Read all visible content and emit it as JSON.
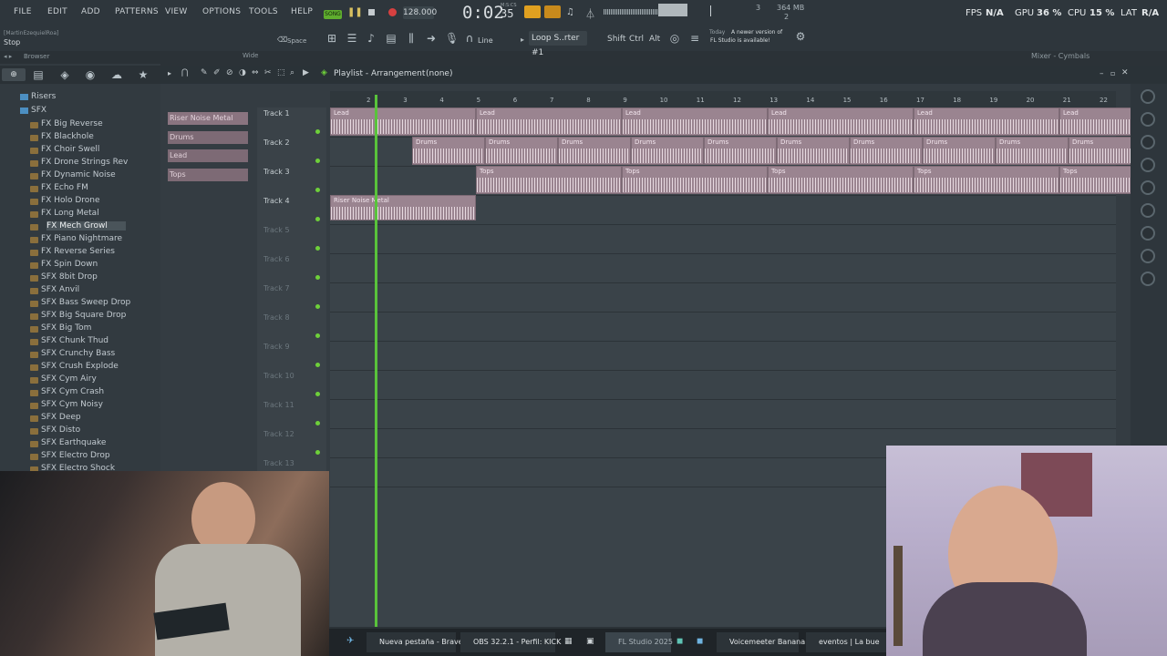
{
  "menu": {
    "items": [
      "FILE",
      "EDIT",
      "ADD",
      "PATTERNS",
      "VIEW",
      "OPTIONS",
      "TOOLS",
      "HELP"
    ],
    "song_mode": "SONG",
    "tempo": "128.000",
    "time": "0:02",
    "time_small": "35",
    "time_unit": "M:S:CS"
  },
  "status": {
    "fps_label": "FPS",
    "fps_value": "N/A",
    "gpu_label": "GPU",
    "gpu_value": "36 %",
    "cpu_label": "CPU",
    "cpu_value": "15 %",
    "lat_label": "LAT",
    "lat_value": "R/A",
    "memory": "364 MB",
    "voices": "3",
    "voices2": "2"
  },
  "hint": {
    "user": "[MartinEzequielRoa]",
    "action": "Stop"
  },
  "toolbar2": {
    "space_label": "Space",
    "snap_label": "Line",
    "loop_label": "Loop S..rter #1",
    "shift_label": "Shift",
    "ctrl_label": "Ctrl",
    "alt_label": "Alt",
    "news_today": "Today",
    "news_text": "A newer version of",
    "news_text2": "FL Studio is available!"
  },
  "browser": {
    "title": "Browser",
    "wide_label": "Wide",
    "mixer_title": "Mixer - Cymbals",
    "folders": [
      "Risers",
      "SFX"
    ],
    "items": [
      "FX Big Reverse",
      "FX Blackhole",
      "FX Choir Swell",
      "FX Drone Strings Rev",
      "FX Dynamic Noise",
      "FX Echo FM",
      "FX Holo Drone",
      "FX Long Metal",
      "FX Mech Growl",
      "FX Piano Nightmare",
      "FX Reverse Series",
      "FX Spin Down",
      "SFX 8bit Drop",
      "SFX Anvil",
      "SFX Bass Sweep Drop",
      "SFX Big Square Drop",
      "SFX Big Tom",
      "SFX Chunk Thud",
      "SFX Crunchy Bass",
      "SFX Crush Explode",
      "SFX Cym Airy",
      "SFX Cym Crash",
      "SFX Cym Noisy",
      "SFX Deep",
      "SFX Disto",
      "SFX Earthquake",
      "SFX Electro Drop",
      "SFX Electro Shock"
    ]
  },
  "playlist": {
    "title": "Playlist - Arrangement",
    "pattern": "(none)",
    "patterns": [
      "Riser Noise Metal",
      "Drums",
      "Lead",
      "Tops"
    ],
    "tracks": [
      "Track 1",
      "Track 2",
      "Track 3",
      "Track 4",
      "Track 5",
      "Track 6",
      "Track 7",
      "Track 8",
      "Track 9",
      "Track 10",
      "Track 11",
      "Track 12",
      "Track 13"
    ],
    "bar_numbers": [
      "2",
      "3",
      "4",
      "5",
      "6",
      "7",
      "8",
      "9",
      "10",
      "11",
      "12",
      "13",
      "14",
      "15",
      "16",
      "17",
      "18",
      "19",
      "20",
      "21",
      "22"
    ],
    "clip_lead": "Lead",
    "clip_drums": "Drums",
    "clip_tops": "Tops",
    "clip_riser": "Riser Noise Metal"
  },
  "taskbar": {
    "items": [
      "Nueva pestaña - Brave",
      "OBS 32.2.1 - Perfil: KICK",
      "FL Studio 2025",
      "Voicemeeter Banana",
      "eventos | La bue"
    ]
  }
}
